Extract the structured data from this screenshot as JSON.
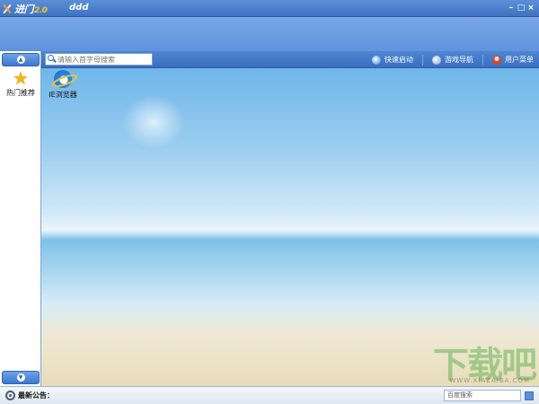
{
  "titlebar": {
    "logo_text": "进门",
    "logo_suffix": "2.0",
    "title": "ddd",
    "minimize": "–",
    "maximize": "□",
    "close": "×"
  },
  "sidebar": {
    "scroll_up": "▲",
    "scroll_down": "▼",
    "items": [
      {
        "label": "热门推荐",
        "icon": "star-icon"
      }
    ]
  },
  "toolbar": {
    "search_placeholder": "请输入首字母搜索",
    "menu": [
      {
        "label": "快速启动",
        "icon": "rocket-icon"
      },
      {
        "label": "游戏导航",
        "icon": "game-icon"
      },
      {
        "label": "用户菜单",
        "icon": "user-icon"
      }
    ]
  },
  "desktop": {
    "icons": [
      {
        "label": "IE浏览器",
        "icon": "ie-icon"
      }
    ]
  },
  "statusbar": {
    "notice_label": "最新公告：",
    "right_text": "百度搜索"
  },
  "watermark": {
    "text": "下载吧",
    "url": "WWW.XIAZAIBA.COM"
  }
}
